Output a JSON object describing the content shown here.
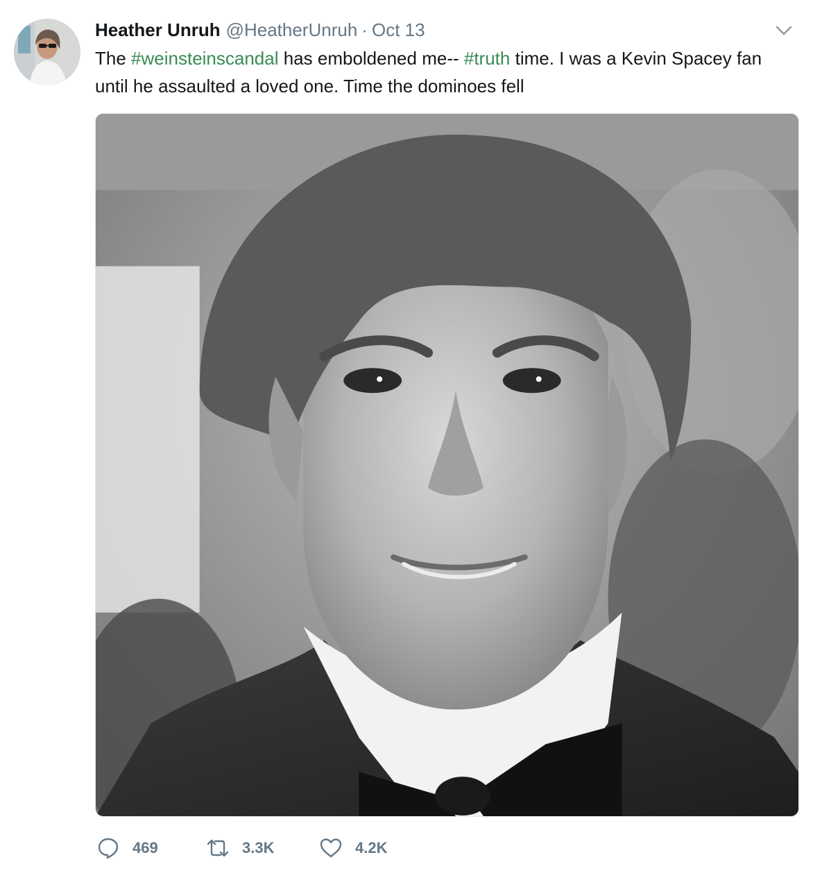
{
  "tweet": {
    "author": {
      "name": "Heather Unruh",
      "handle": "@HeatherUnruh",
      "separator": "·",
      "date": "Oct 13"
    },
    "text": {
      "t1": "The ",
      "hashtag1": "#weinsteinscandal",
      "t2": " has emboldened me-- ",
      "hashtag2": "#truth",
      "t3": " time.  I was a Kevin Spacey fan until he assaulted a loved one.  Time the dominoes fell"
    },
    "stats": {
      "replies": "469",
      "retweets": "3.3K",
      "likes": "4.2K"
    }
  },
  "icons": {
    "menu": "chevron-down-icon",
    "reply": "reply-icon",
    "retweet": "retweet-icon",
    "like": "heart-icon"
  },
  "colors": {
    "hashtag": "#3a8a52",
    "secondary_text": "#657786",
    "primary_text": "#14171a"
  }
}
